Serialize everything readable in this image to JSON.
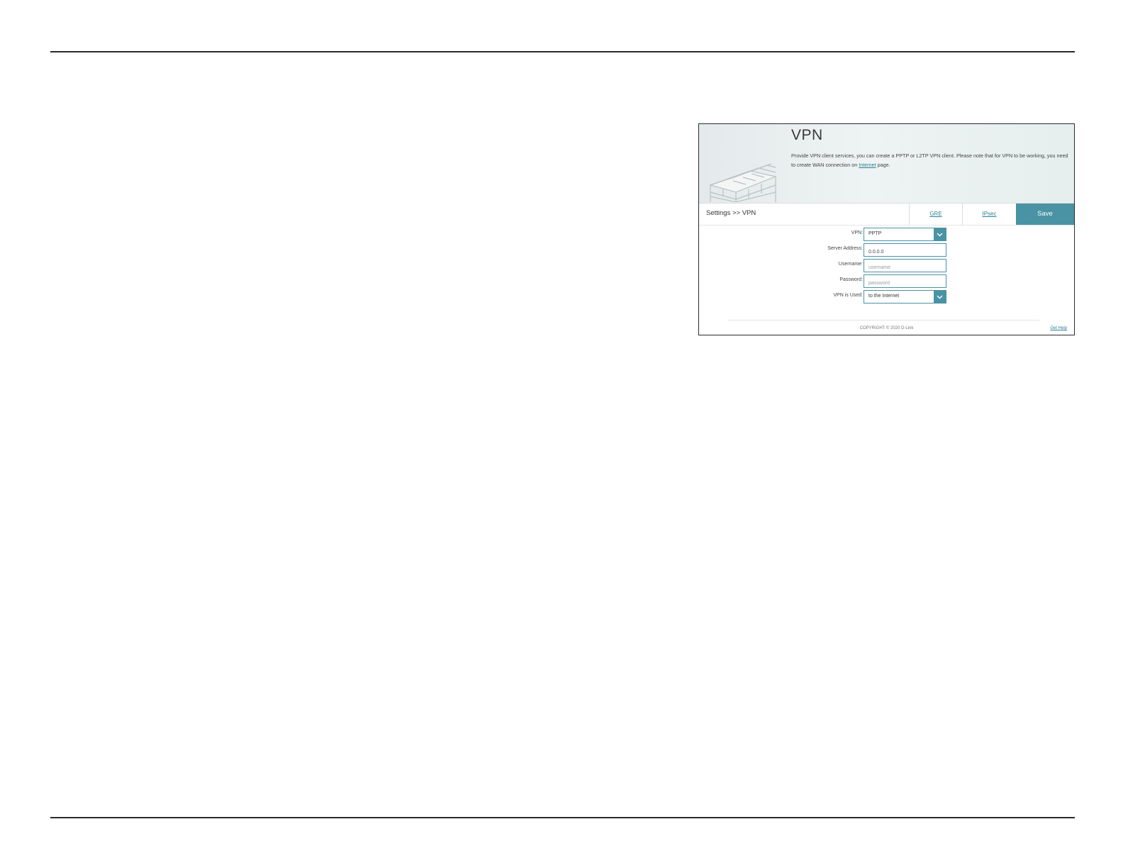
{
  "panel": {
    "title": "VPN",
    "description_before_link": "Provide VPN client services, you can create a PPTP or L2TP VPN client. Please note that for VPN to be working, you need to create WAN connection on ",
    "description_link": "Internet",
    "description_after_link": " page.",
    "breadcrumb": "Settings >> VPN",
    "tabs": [
      {
        "label": "GRE"
      },
      {
        "label": "IPsec"
      }
    ],
    "save_label": "Save",
    "form": {
      "vpn": {
        "label": "VPN:",
        "value": "PPTP"
      },
      "server_address": {
        "label": "Server Address:",
        "value": "0.0.0.0"
      },
      "username": {
        "label": "Username:",
        "placeholder": "username"
      },
      "password": {
        "label": "Password:",
        "placeholder": "password"
      },
      "vpn_is_used": {
        "label": "VPN is Used:",
        "value": "to the Internet"
      }
    },
    "copyright": "COPYRIGHT © 2020 D-Link",
    "get_help": "Get Help"
  },
  "colors": {
    "accent": "#4a93a4",
    "link": "#2e7f92",
    "rule": "#2a2a2a"
  }
}
